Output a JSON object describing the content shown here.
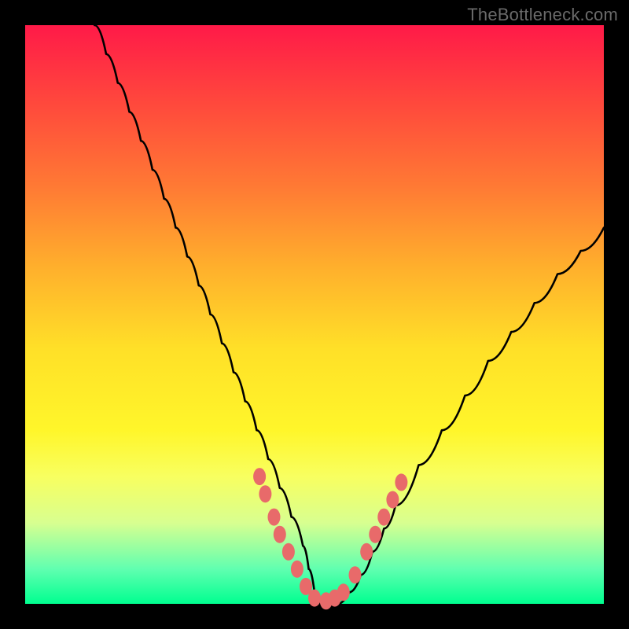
{
  "watermark": "TheBottleneck.com",
  "chart_data": {
    "type": "line",
    "title": "",
    "xlabel": "",
    "ylabel": "",
    "xlim": [
      0,
      100
    ],
    "ylim": [
      0,
      100
    ],
    "series": [
      {
        "name": "curve",
        "color": "#000000",
        "x": [
          12,
          14,
          16,
          18,
          20,
          22,
          24,
          26,
          28,
          30,
          32,
          34,
          36,
          38,
          40,
          42,
          44,
          46,
          48,
          49,
          50,
          51,
          52,
          54,
          56,
          58,
          60,
          62,
          64,
          68,
          72,
          76,
          80,
          84,
          88,
          92,
          96,
          100
        ],
        "y": [
          100,
          95,
          90,
          85,
          80,
          75,
          70,
          65,
          60,
          55,
          50,
          45,
          40,
          35,
          30,
          25,
          20,
          15,
          10,
          6,
          2,
          0,
          0,
          0,
          2,
          5,
          9,
          13,
          17,
          24,
          30,
          36,
          42,
          47,
          52,
          57,
          61,
          65
        ]
      },
      {
        "name": "dots",
        "color": "#e86a6a",
        "points": [
          {
            "x": 40.5,
            "y": 22
          },
          {
            "x": 41.5,
            "y": 19
          },
          {
            "x": 43,
            "y": 15
          },
          {
            "x": 44,
            "y": 12
          },
          {
            "x": 45.5,
            "y": 9
          },
          {
            "x": 47,
            "y": 6
          },
          {
            "x": 48.5,
            "y": 3
          },
          {
            "x": 50,
            "y": 1
          },
          {
            "x": 52,
            "y": 0.5
          },
          {
            "x": 53.5,
            "y": 1
          },
          {
            "x": 55,
            "y": 2
          },
          {
            "x": 57,
            "y": 5
          },
          {
            "x": 59,
            "y": 9
          },
          {
            "x": 60.5,
            "y": 12
          },
          {
            "x": 62,
            "y": 15
          },
          {
            "x": 63.5,
            "y": 18
          },
          {
            "x": 65,
            "y": 21
          }
        ]
      }
    ]
  }
}
